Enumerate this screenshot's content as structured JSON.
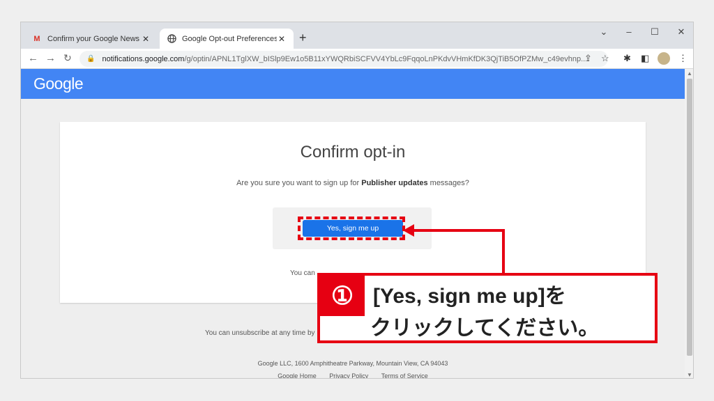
{
  "tabs": [
    {
      "title": "Confirm your Google News Email",
      "icon": "gmail-icon"
    },
    {
      "title": "Google Opt-out Preferences",
      "icon": "globe-icon"
    }
  ],
  "new_tab_label": "+",
  "window_controls": {
    "chevron": "⌄",
    "minimize": "–",
    "maximize": "☐",
    "close": "✕"
  },
  "url": {
    "host": "notifications.google.com",
    "path": "/g/optin/APNL1TglXW_bISlp9Ew1o5B11xYWQRbiSCFVV4YbLc9FqqoLnPKdvVHmKfDK3QjTiB5OfPZMw_c49evhnp..."
  },
  "page": {
    "logo": "Google",
    "title": "Confirm opt-in",
    "question_prefix": "Are you sure you want to sign up for ",
    "question_bold": "Publisher updates",
    "question_suffix": " messages?",
    "confirm_button": "Yes, sign me up",
    "note_start": "You can",
    "unsubscribe_start": "You can unsubscribe at any time by",
    "address": "Google LLC, 1600 Amphitheatre Parkway, Mountain View, CA 94043",
    "footer_links": [
      "Google Home",
      "Privacy Policy",
      "Terms of Service"
    ]
  },
  "callout": {
    "number": "①",
    "line1": "[Yes, sign me up]を",
    "line2": "クリックしてください。"
  },
  "colors": {
    "google_blue": "#4285f4",
    "button_blue": "#1a73e8",
    "annotation_red": "#e60012"
  }
}
